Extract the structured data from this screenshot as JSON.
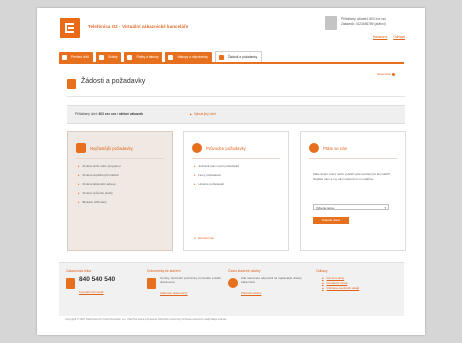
{
  "header": {
    "brand": "Telefónica O2 · Virtuální zákaznické kanceláře",
    "user_line1": "Přihlášený uživatel: 603 xxx xxx",
    "user_line2": "Zákazník: 0123456789 (aktivní)",
    "link_settings": "Nastavení",
    "link_logout": "Odhlásit"
  },
  "tabs": [
    {
      "label": "Přehled účtů"
    },
    {
      "label": "Služby"
    },
    {
      "label": "Platby a faktury"
    },
    {
      "label": "Nákupy a objednávky"
    },
    {
      "label": "Žádosti a požadavky"
    }
  ],
  "page": {
    "title": "Žádosti a požadavky",
    "help": "Nápověda",
    "info_prefix": "Přihlášený účet: ",
    "info_account": "603 xxx xxx / aktivní zákazník",
    "info_link": "Vybrat jiný účet"
  },
  "panels": {
    "top": {
      "title": "Nejčastější požadavky",
      "items": [
        "Změna tarifu nebo programu",
        "Změna doplňkových služeb",
        "Změna fakturační adresy",
        "Změna způsobu platby",
        "Blokace SIM karty"
      ]
    },
    "other": {
      "title": "Průvodce požadavky",
      "items": [
        "Zobrazit stav mých požadavků",
        "Nový požadavek",
        "Historie požadavků"
      ],
      "footer": "Zobrazit vše"
    },
    "ask": {
      "title": "Ptáte se nás",
      "text": "Máte dotaz, který nelze vyřešit výše uvedenými formuláři? Napište nám a my vám odpovíme co nejdříve.",
      "select_value": "Vyberte téma",
      "button": "Odeslat dotaz"
    }
  },
  "footer": {
    "col1": {
      "title": "Zákaznická linka",
      "phone": "840 540 540",
      "link": "Kontaktní formulář"
    },
    "col2": {
      "title": "Dokumenty ke stažení",
      "text": "Ceníky, obchodní podmínky, formuláře a další dokumenty.",
      "link": "Stáhnout dokumenty"
    },
    "col3": {
      "title": "Často kladené otázky",
      "text": "Zde naleznete odpovědi na nejčastější dotazy zákazníků.",
      "link": "Zobrazit otázky"
    },
    "col4": {
      "title": "Odkazy",
      "links": [
        "Ceník a tarify",
        "Kontaktní místa",
        "Ochrana osobních údajů"
      ]
    },
    "copyright": "Copyright © 2007 Telefónica O2 Czech Republic, a.s.   Všechna práva vyhrazena   Obchodní podmínky   Ochrana osobních údajů   Mapa stránek"
  }
}
